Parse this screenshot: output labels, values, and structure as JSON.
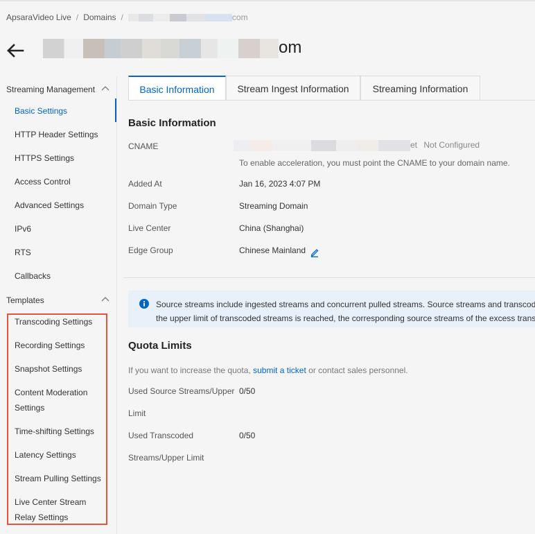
{
  "breadcrumb": {
    "root": "ApsaraVideo Live",
    "domains": "Domains",
    "domain_suffix": "com"
  },
  "page": {
    "title_suffix": "om"
  },
  "sidebar": {
    "group1": "Streaming Management",
    "items1": [
      "Basic Settings",
      "HTTP Header Settings",
      "HTTPS Settings",
      "Access Control",
      "Advanced Settings",
      "IPv6",
      "RTS",
      "Callbacks"
    ],
    "group2": "Templates",
    "items2": [
      "Transcoding Settings",
      "Recording Settings",
      "Snapshot Settings",
      "Content Moderation Settings",
      "Time-shifting Settings",
      "Latency Settings",
      "Stream Pulling Settings",
      "Live Center Stream Relay Settings"
    ]
  },
  "tabs": [
    "Basic Information",
    "Stream Ingest Information",
    "Streaming Information"
  ],
  "basic": {
    "heading": "Basic Information",
    "cname_label": "CNAME",
    "cname_tail": "et",
    "cname_status": "Not Configured",
    "cname_hint": "To enable acceleration, you must point the CNAME to your domain name.",
    "added_label": "Added At",
    "added_value": "Jan 16, 2023 4:07 PM",
    "type_label": "Domain Type",
    "type_value": "Streaming Domain",
    "center_label": "Live Center",
    "center_value": "China (Shanghai)",
    "edge_label": "Edge Group",
    "edge_value": "Chinese Mainland"
  },
  "notice": {
    "line1": "Source streams include ingested streams and concurrent pulled streams. Source streams and transcoded",
    "line2": "the upper limit of transcoded streams is reached, the corresponding source streams of the excess transco"
  },
  "quota": {
    "heading": "Quota Limits",
    "hint_prefix": "If you want to increase the quota,",
    "hint_link": "submit a ticket",
    "hint_suffix": "or contact sales personnel.",
    "source_label_1": "Used Source Streams/Upper",
    "source_label_2": "Limit",
    "source_value": "0/50",
    "trans_label_1": "Used Transcoded",
    "trans_label_2": "Streams/Upper Limit",
    "trans_value": "0/50"
  },
  "colors": {
    "accent": "#0064c8",
    "highlight": "#e5533b",
    "notice_bg": "#e8f0fa"
  },
  "icons": {
    "back": "arrow-left-icon",
    "collapse": "chevron-up-icon",
    "edit": "pencil-icon",
    "info": "info-circle-icon"
  }
}
